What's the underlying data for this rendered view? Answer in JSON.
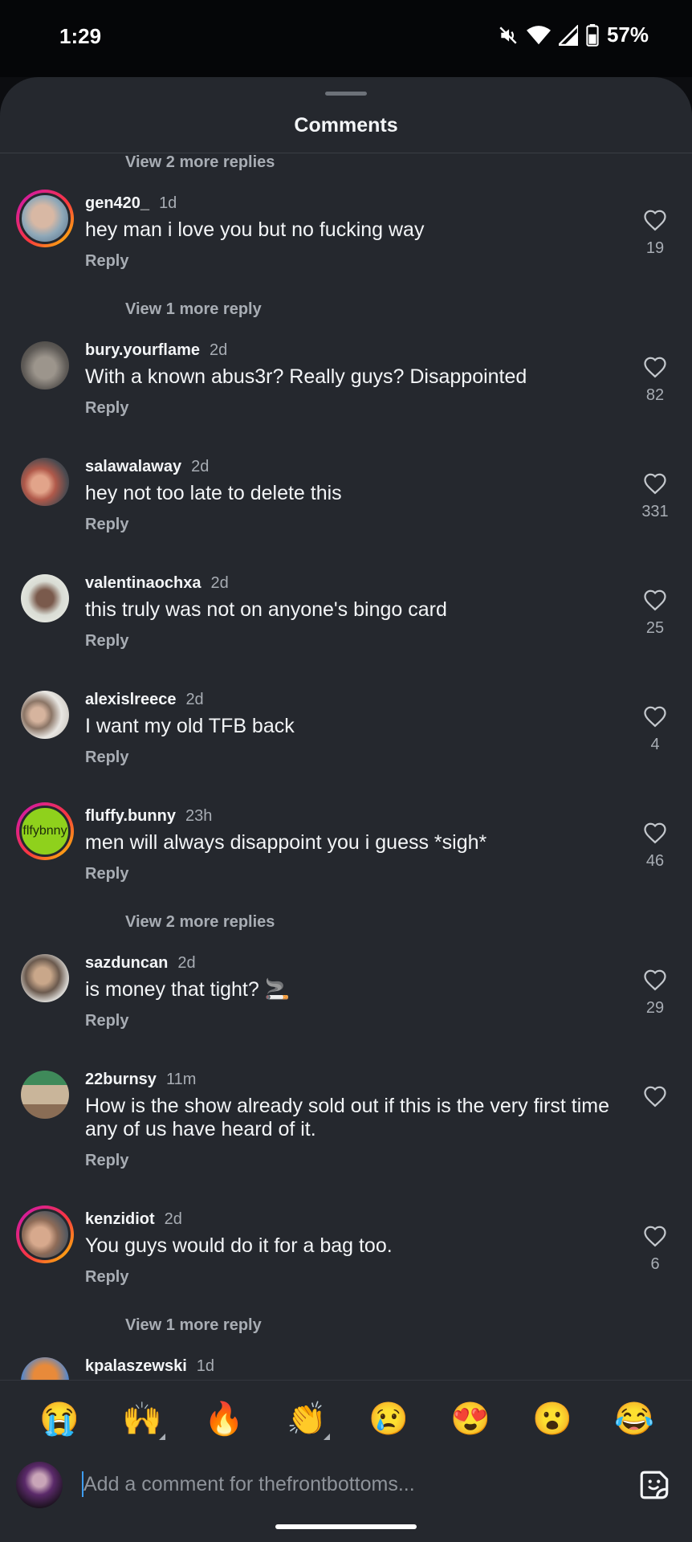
{
  "status_bar": {
    "time": "1:29",
    "battery": "57%",
    "icons": [
      "mute-icon",
      "wifi-icon",
      "signal-icon",
      "battery-icon"
    ]
  },
  "sheet": {
    "title": "Comments"
  },
  "view_replies": {
    "top": "View 2 more replies",
    "after_gen420": "View 1 more reply",
    "after_fluffy": "View 2 more replies",
    "after_kenzidiot": "View 1 more reply"
  },
  "comments": [
    {
      "username": "gen420_",
      "time": "1d",
      "text": "hey man i love you but no fucking way",
      "reply": "Reply",
      "likes": "19"
    },
    {
      "username": "bury.yourflame",
      "time": "2d",
      "text": "With a known abus3r? Really guys? Disappointed",
      "reply": "Reply",
      "likes": "82"
    },
    {
      "username": "salawalaway",
      "time": "2d",
      "text": "hey not too late to delete this",
      "reply": "Reply",
      "likes": "331"
    },
    {
      "username": "valentinaochxa",
      "time": "2d",
      "text": "this truly was not on anyone's bingo card",
      "reply": "Reply",
      "likes": "25"
    },
    {
      "username": "alexislreece",
      "time": "2d",
      "text": "I want my old TFB back",
      "reply": "Reply",
      "likes": "4"
    },
    {
      "username": "fluffy.bunny",
      "time": "23h",
      "text": "men will always disappoint you i guess *sigh*",
      "reply": "Reply",
      "likes": "46",
      "avatar_text": "flfybnny"
    },
    {
      "username": "sazduncan",
      "time": "2d",
      "text": "is money that tight? 🚬",
      "reply": "Reply",
      "likes": "29"
    },
    {
      "username": "22burnsy",
      "time": "11m",
      "text": "How is the show already sold out if this is the very first time any of us have heard of it.",
      "reply": "Reply",
      "likes": ""
    },
    {
      "username": "kenzidiot",
      "time": "2d",
      "text": "You guys would do it for a bag too.",
      "reply": "Reply",
      "likes": "6"
    },
    {
      "username": "kpalaszewski",
      "time": "1d",
      "text": "",
      "reply": "",
      "likes": ""
    }
  ],
  "emoji_bar": [
    "😭",
    "🙌",
    "🔥",
    "👏",
    "😢",
    "😍",
    "😮",
    "😂"
  ],
  "input": {
    "placeholder": "Add a comment for thefrontbottoms..."
  },
  "colors": {
    "sheet_bg": "#25282e",
    "status_bg": "#050608",
    "primary_text": "#f3f5f7",
    "secondary_text": "#a8adb4",
    "caret": "#3d9df2",
    "story_ring": [
      "#c913b9",
      "#f9373f",
      "#fecd00"
    ],
    "fluffy_avatar_bg": "#8fd11c"
  }
}
